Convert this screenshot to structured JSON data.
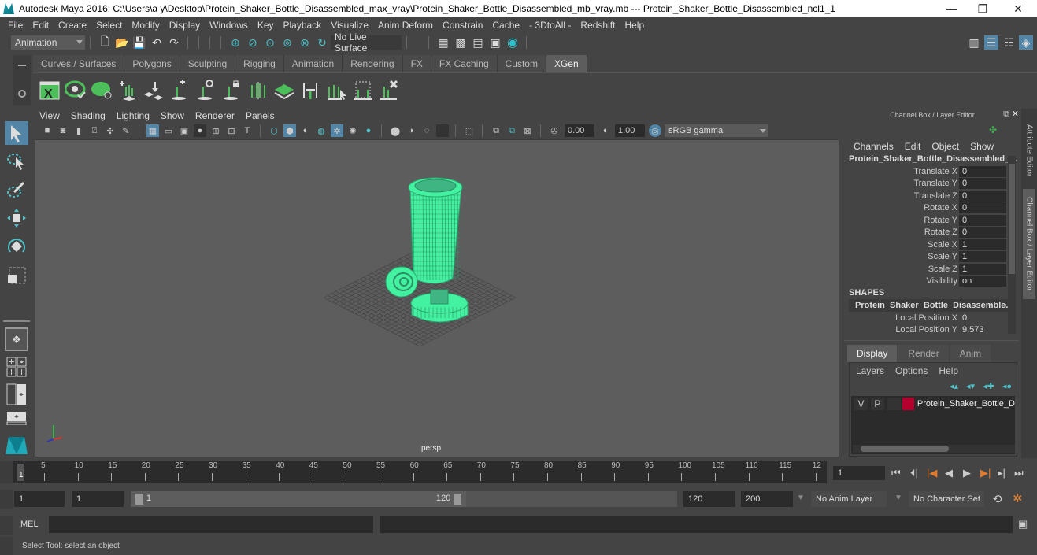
{
  "window": {
    "title": "Autodesk Maya 2016: C:\\Users\\a y\\Desktop\\Protein_Shaker_Bottle_Disassembled_max_vray\\Protein_Shaker_Bottle_Disassembled_mb_vray.mb   ---   Protein_Shaker_Bottle_Disassembled_ncl1_1",
    "minimize": "—",
    "maximize": "❐",
    "close": "✕"
  },
  "menubar": [
    "File",
    "Edit",
    "Create",
    "Select",
    "Modify",
    "Display",
    "Windows",
    "Key",
    "Playback",
    "Visualize",
    "Anim Deform",
    "Constrain",
    "Cache",
    "- 3DtoAll -",
    "Redshift",
    "Help"
  ],
  "statusline": {
    "menuset": "Animation",
    "live_surface": "No Live Surface"
  },
  "shelf": {
    "tabs": [
      "Curves / Surfaces",
      "Polygons",
      "Sculpting",
      "Rigging",
      "Animation",
      "Rendering",
      "FX",
      "FX Caching",
      "Custom",
      "XGen"
    ],
    "active_tab": "XGen",
    "icons": [
      "xgen-editor-icon",
      "preview-icon",
      "clear-preview-icon",
      "add-description-icon",
      "place-guides-icon",
      "add-guide-icon",
      "show-guides-icon",
      "lock-guides-icon",
      "grooming-icon",
      "patch-icon",
      "guide-length-icon",
      "select-guides-icon",
      "delete-guides-icon",
      "remove-guides-icon"
    ]
  },
  "viewport": {
    "menus": [
      "View",
      "Shading",
      "Lighting",
      "Show",
      "Renderer",
      "Panels"
    ],
    "exposure": "0.00",
    "gamma": "1.00",
    "color_space": "sRGB gamma",
    "camera_label": "persp",
    "accent": "#5285a6",
    "wire_color": "#43f2a0"
  },
  "channel_box": {
    "header": "Channel Box / Layer Editor",
    "menus": [
      "Channels",
      "Edit",
      "Object",
      "Show"
    ],
    "object_name": "Protein_Shaker_Bottle_Disassembled_...",
    "channels": [
      {
        "label": "Translate X",
        "value": "0"
      },
      {
        "label": "Translate Y",
        "value": "0"
      },
      {
        "label": "Translate Z",
        "value": "0"
      },
      {
        "label": "Rotate X",
        "value": "0"
      },
      {
        "label": "Rotate Y",
        "value": "0"
      },
      {
        "label": "Rotate Z",
        "value": "0"
      },
      {
        "label": "Scale X",
        "value": "1"
      },
      {
        "label": "Scale Y",
        "value": "1"
      },
      {
        "label": "Scale Z",
        "value": "1"
      },
      {
        "label": "Visibility",
        "value": "on"
      }
    ],
    "shapes_label": "SHAPES",
    "shape_name": "Protein_Shaker_Bottle_Disassemble...",
    "shape_channels": [
      {
        "label": "Local Position X",
        "value": "0"
      },
      {
        "label": "Local Position Y",
        "value": "9.573"
      }
    ]
  },
  "side_tabs": [
    "Attribute Editor",
    "Channel Box / Layer Editor"
  ],
  "layer_editor": {
    "tabs": [
      "Display",
      "Render",
      "Anim"
    ],
    "active_tab": "Display",
    "menus": [
      "Layers",
      "Options",
      "Help"
    ],
    "layers": [
      {
        "v": "V",
        "p": "P",
        "name": "Protein_Shaker_Bottle_D",
        "color": "#b3002d"
      }
    ]
  },
  "timeline": {
    "ticks": [
      "5",
      "10",
      "15",
      "20",
      "25",
      "30",
      "35",
      "40",
      "45",
      "50",
      "55",
      "60",
      "65",
      "70",
      "75",
      "80",
      "85",
      "90",
      "95",
      "100",
      "105",
      "110",
      "115",
      "12"
    ],
    "current_frame_marker": "1",
    "current_frame": "1"
  },
  "range": {
    "start": "1",
    "playback_start": "1",
    "slider_start": "1",
    "slider_end": "120",
    "playback_end": "120",
    "end": "200",
    "anim_layer": "No Anim Layer",
    "character_set": "No Character Set"
  },
  "command_line": {
    "label": "MEL"
  },
  "help_line": "Select Tool: select an object"
}
